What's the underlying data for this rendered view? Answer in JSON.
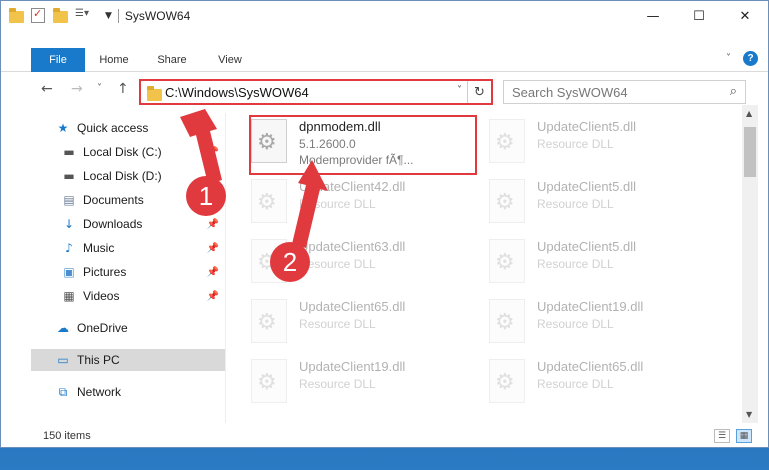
{
  "window": {
    "title": "SysWOW64",
    "controls": [
      "—",
      "☐",
      "✕"
    ]
  },
  "ribbon": {
    "tabs": [
      "File",
      "Home",
      "Share",
      "View"
    ],
    "help": "?"
  },
  "navbar": {
    "back": "←",
    "forward": "→",
    "recent": "˅",
    "up": "↑",
    "address": "C:\\Windows\\SysWOW64",
    "dropdown": "˅",
    "refresh": "↻",
    "search_placeholder": "Search SysWOW64",
    "search_icon": "⌕"
  },
  "sidebar": {
    "items": [
      {
        "label": "Quick access",
        "icon": "star-icon",
        "glyph": "★",
        "color": "#1979ca",
        "pinned": false
      },
      {
        "label": "Local Disk (C:)",
        "icon": "drive-icon",
        "glyph": "▬",
        "color": "#555555",
        "pinned": true
      },
      {
        "label": "Local Disk (D:)",
        "icon": "drive-icon",
        "glyph": "▬",
        "color": "#555555",
        "pinned": true
      },
      {
        "label": "Documents",
        "icon": "documents-icon",
        "glyph": "▤",
        "color": "#6b7d96",
        "pinned": true
      },
      {
        "label": "Downloads",
        "icon": "downloads-icon",
        "glyph": "↓",
        "color": "#1979ca",
        "pinned": true
      },
      {
        "label": "Music",
        "icon": "music-icon",
        "glyph": "♪",
        "color": "#1979ca",
        "pinned": true
      },
      {
        "label": "Pictures",
        "icon": "pictures-icon",
        "glyph": "▣",
        "color": "#4a8fcf",
        "pinned": true
      },
      {
        "label": "Videos",
        "icon": "videos-icon",
        "glyph": "▦",
        "color": "#555555",
        "pinned": true
      },
      {
        "label": "OneDrive",
        "icon": "cloud-icon",
        "glyph": "☁",
        "color": "#1979ca",
        "pinned": false
      },
      {
        "label": "This PC",
        "icon": "computer-icon",
        "glyph": "▭",
        "color": "#1979ca",
        "pinned": false
      },
      {
        "label": "Network",
        "icon": "network-icon",
        "glyph": "⧉",
        "color": "#1979ca",
        "pinned": false
      }
    ],
    "pin_glyph": "📌"
  },
  "files": [
    {
      "name": "dpnmodem.dll",
      "line1": "5.1.2600.0",
      "line2": "Modemprovider fÃ¶...",
      "faded": false
    },
    {
      "name": "UpdateClient5.dll",
      "line1": "Resource DLL",
      "faded": true
    },
    {
      "name": "UpdateClient42.dll",
      "line1": "Resource DLL",
      "faded": true
    },
    {
      "name": "UpdateClient5.dll",
      "line1": "Resource DLL",
      "faded": true
    },
    {
      "name": "UpdateClient63.dll",
      "line1": "Resource DLL",
      "faded": true
    },
    {
      "name": "UpdateClient5.dll",
      "line1": "Resource DLL",
      "faded": true
    },
    {
      "name": "UpdateClient65.dll",
      "line1": "Resource DLL",
      "faded": true
    },
    {
      "name": "UpdateClient19.dll",
      "line1": "Resource DLL",
      "faded": true
    },
    {
      "name": "UpdateClient19.dll",
      "line1": "Resource DLL",
      "faded": true
    },
    {
      "name": "UpdateClient65.dll",
      "line1": "Resource DLL",
      "faded": true
    }
  ],
  "status": {
    "item_count": "150 items"
  },
  "annotations": {
    "step1": "1",
    "step2": "2",
    "color": "#e0393e"
  }
}
